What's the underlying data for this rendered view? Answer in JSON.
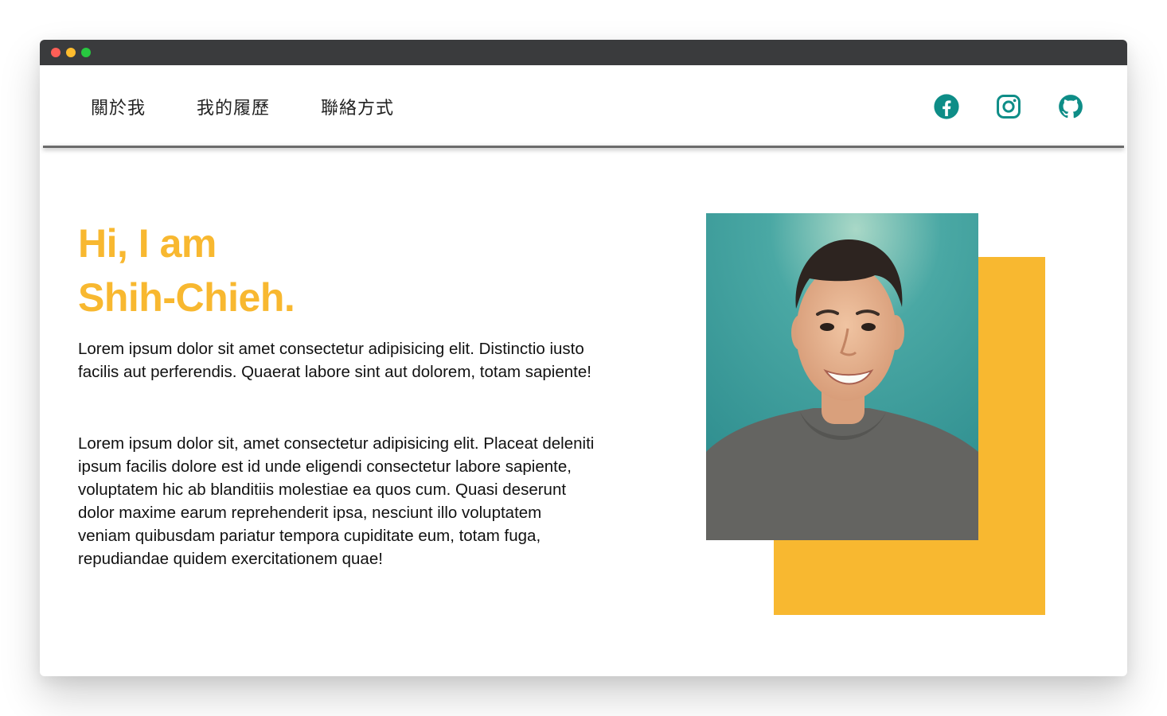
{
  "colors": {
    "accent_yellow": "#f8b830",
    "icon_teal": "#0e8d87",
    "titlebar": "#3a3b3d",
    "dot_red": "#ff5f57",
    "dot_yellow": "#febc2e",
    "dot_green": "#28c840"
  },
  "nav": {
    "links": [
      {
        "label": "關於我"
      },
      {
        "label": "我的履歷"
      },
      {
        "label": "聯絡方式"
      }
    ],
    "icons": [
      "facebook-icon",
      "instagram-icon",
      "github-icon"
    ]
  },
  "hero": {
    "line1": "Hi, I am",
    "line2": "Shih-Chieh.",
    "paragraph1": "Lorem ipsum dolor sit amet consectetur adipisicing elit. Distinctio iusto facilis aut perferendis. Quaerat labore sint aut dolorem, totam sapiente!",
    "paragraph2": "Lorem ipsum dolor sit, amet consectetur adipisicing elit. Placeat deleniti ipsum facilis dolore est id unde eligendi consectetur labore sapiente, voluptatem hic ab blanditiis molestiae ea quos cum. Quasi deserunt dolor maxime earum reprehenderit ipsa, nesciunt illo voluptatem veniam quibusdam pariatur tempora cupiditate eum, totam fuga, repudiandae quidem exercitationem quae!"
  }
}
